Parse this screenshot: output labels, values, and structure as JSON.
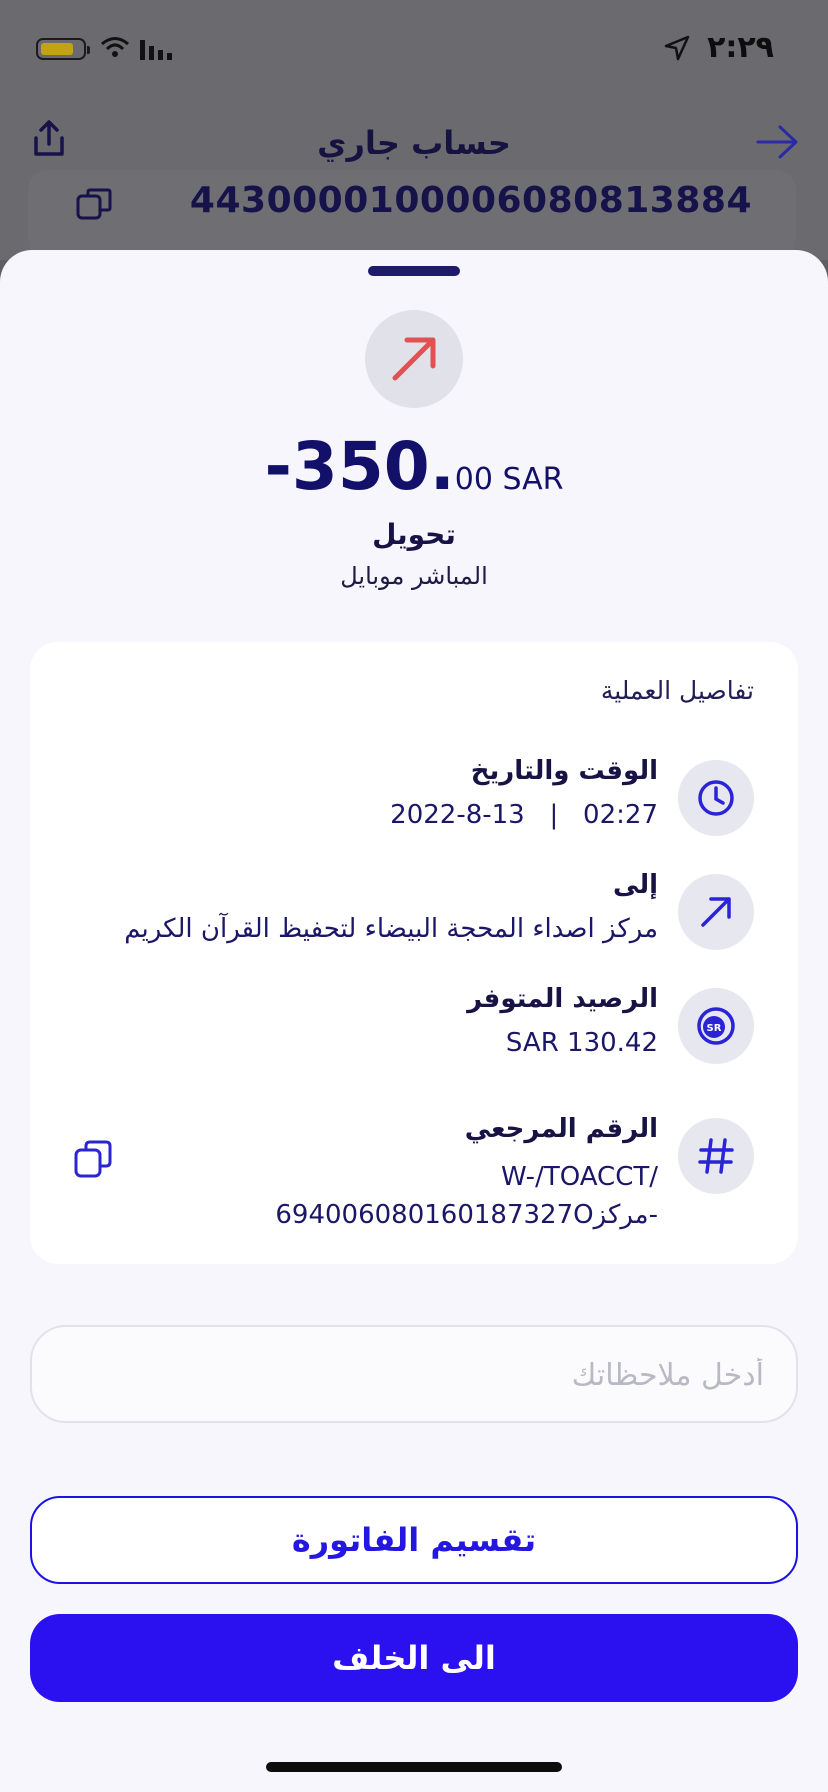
{
  "status_bar": {
    "time": "٢:٢٩"
  },
  "background": {
    "title": "حساب جاري",
    "account_number": "4430000100006080813884"
  },
  "transaction": {
    "amount_main": "-350.",
    "amount_cents": "00 SAR",
    "type": "تحويل",
    "channel": "المباشر موبايل",
    "icon": "outgoing-arrow-icon"
  },
  "details": {
    "title": "تفاصيل العملية",
    "datetime": {
      "label": "الوقت والتاريخ",
      "value": "2022-8-13   |   02:27"
    },
    "to": {
      "label": "إلى",
      "value": "مركز اصداء المحجة البيضاء لتحفيظ القرآن الكريم"
    },
    "balance": {
      "label": "الرصيد المتوفر",
      "value": "SAR 130.42"
    },
    "reference": {
      "label": "الرقم المرجعي",
      "line1": "W-/TOACCT/",
      "line2": "694006080160187327Oمركز-"
    }
  },
  "notes": {
    "placeholder": "أدخل ملاحظاتك"
  },
  "buttons": {
    "split_bill": "تقسيم الفاتورة",
    "back": "الى الخلف"
  },
  "colors": {
    "primary": "#2b10f0",
    "navy": "#1a1566",
    "outgoing": "#e05252",
    "sheet_bg": "#f6f6fc"
  }
}
